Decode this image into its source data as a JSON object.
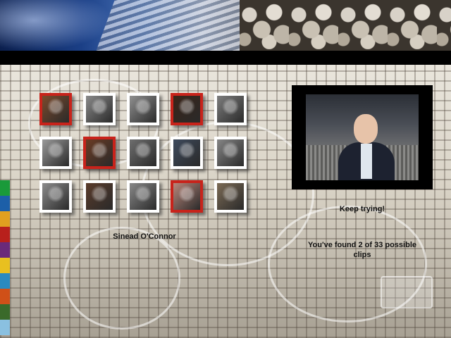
{
  "thumbnails": [
    {
      "row": 0,
      "col": 0,
      "found": true,
      "tone": "#7b4a2c"
    },
    {
      "row": 0,
      "col": 1,
      "found": false,
      "tone": "#8a8a8a"
    },
    {
      "row": 0,
      "col": 2,
      "found": false,
      "tone": "#909090"
    },
    {
      "row": 0,
      "col": 3,
      "found": true,
      "tone": "#3a2418"
    },
    {
      "row": 0,
      "col": 4,
      "found": false,
      "tone": "#7d7d7d"
    },
    {
      "row": 1,
      "col": 0,
      "found": false,
      "tone": "#9a9a9a"
    },
    {
      "row": 1,
      "col": 1,
      "found": true,
      "tone": "#6b3b24"
    },
    {
      "row": 1,
      "col": 2,
      "found": false,
      "tone": "#6e6e6e"
    },
    {
      "row": 1,
      "col": 3,
      "found": false,
      "tone": "#3d4a5c"
    },
    {
      "row": 1,
      "col": 4,
      "found": false,
      "tone": "#858585"
    },
    {
      "row": 2,
      "col": 0,
      "found": false,
      "tone": "#8c8c8c"
    },
    {
      "row": 2,
      "col": 1,
      "found": false,
      "tone": "#5a3b2a"
    },
    {
      "row": 2,
      "col": 2,
      "found": false,
      "tone": "#888888"
    },
    {
      "row": 2,
      "col": 3,
      "found": true,
      "tone": "#b9867a"
    },
    {
      "row": 2,
      "col": 4,
      "found": false,
      "tone": "#7b6a55"
    }
  ],
  "selected_name": "Sinead O'Connor",
  "status": {
    "message": "Keep trying!",
    "progress": "You've found 2 of 33 possible clips"
  },
  "colors": {
    "found_border": "#c8231b",
    "strip": [
      "#1a9a3a",
      "#1c5fa8",
      "#e0a020",
      "#b8201c",
      "#6a2a7a",
      "#e8c020",
      "#2a8ac0",
      "#d05018",
      "#3a6a2a",
      "#8ac0e0"
    ]
  }
}
